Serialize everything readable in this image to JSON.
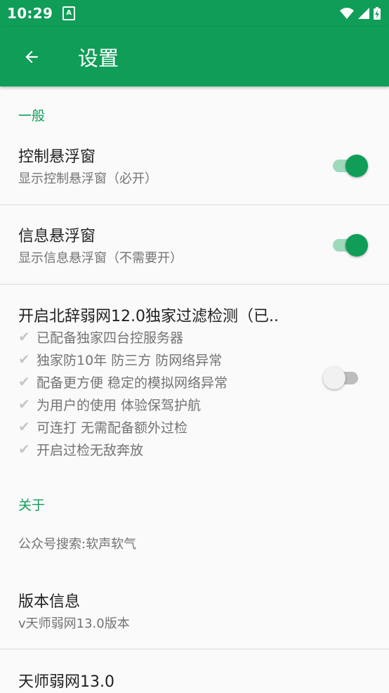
{
  "status_bar": {
    "time": "10:29",
    "notification_letter": "A"
  },
  "app_bar": {
    "title": "设置"
  },
  "colors": {
    "accent": "#0f9d58",
    "text_secondary": "#737373"
  },
  "sections": {
    "general": {
      "header": "一般",
      "control_float": {
        "title": "控制悬浮窗",
        "summary": "显示控制悬浮窗（必开）",
        "enabled": true
      },
      "info_float": {
        "title": "信息悬浮窗",
        "summary": "显示信息悬浮窗（不需要开）",
        "enabled": true
      },
      "filter_detect": {
        "title": "开启北辞弱网12.0独家过滤检测（已..",
        "features": [
          "已配备独家四台控服务器",
          "独家防10年 防三方 防网络异常",
          "配备更方便 稳定的模拟网络异常",
          "为用户的使用 体验保驾护航",
          "可连打 无需配备额外过检",
          "开启过检无敌奔放"
        ],
        "enabled": false
      }
    },
    "about": {
      "header": "关于",
      "wechat": {
        "summary": "公众号搜索:软声软气"
      },
      "version": {
        "title": "版本信息",
        "summary": "v天师弱网13.0版本"
      },
      "app_name": {
        "title": "天师弱网13.0"
      }
    }
  }
}
